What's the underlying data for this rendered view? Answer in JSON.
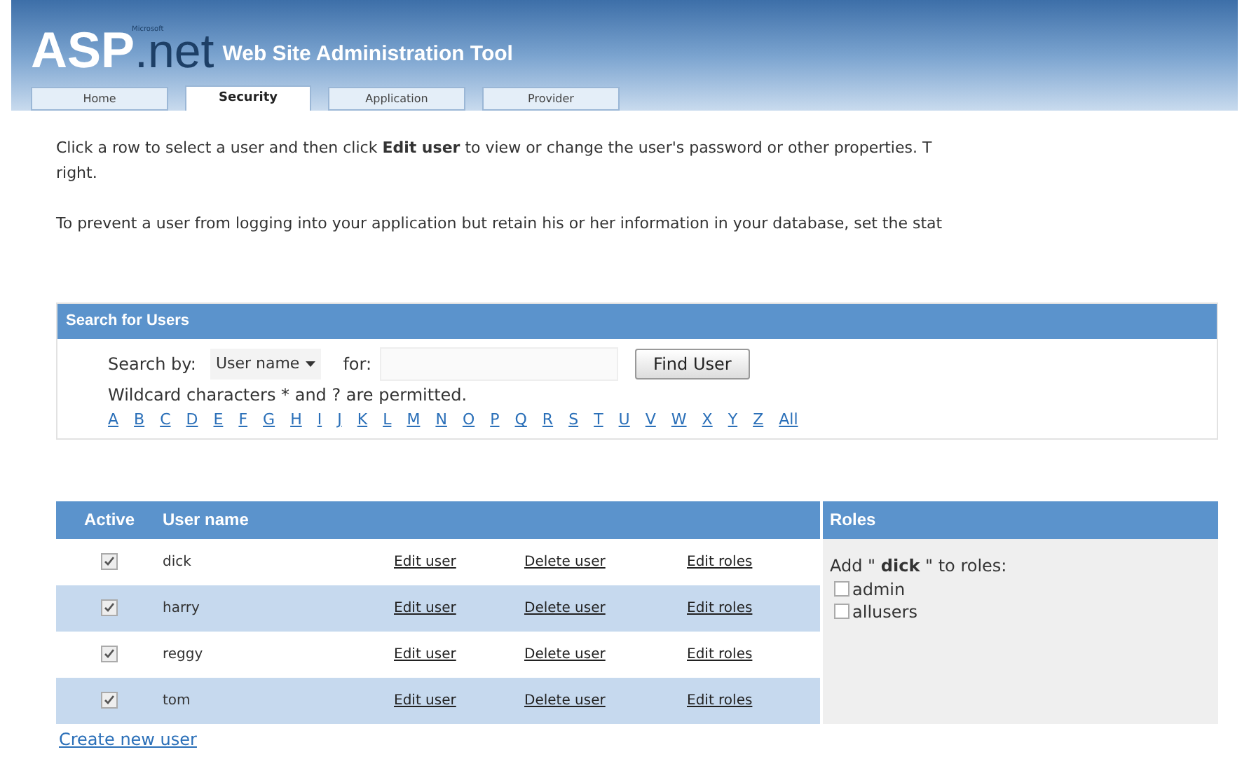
{
  "header": {
    "logo_main": "ASP",
    "logo_sub": ".net",
    "logo_small": "Microsoft",
    "title": "Web Site Administration Tool"
  },
  "tabs": [
    {
      "label": "Home",
      "selected": false
    },
    {
      "label": "Security",
      "selected": true
    },
    {
      "label": "Application",
      "selected": false
    },
    {
      "label": "Provider",
      "selected": false
    }
  ],
  "intro": {
    "paragraph_1": [
      "Click a row to select a user and then click **Edit user** to view or change the user's password or other properties. T",
      "right."
    ],
    "paragraph_2": "To prevent a user from logging into your application but retain his or her information in your database, set the stat"
  },
  "search": {
    "title": "Search for Users",
    "search_by_label": "Search by:",
    "search_by_value": "User name",
    "for_label": "for:",
    "button": "Find User",
    "hint": "Wildcard characters * and ? are permitted.",
    "letters": [
      "A",
      "B",
      "C",
      "D",
      "E",
      "F",
      "G",
      "H",
      "I",
      "J",
      "K",
      "L",
      "M",
      "N",
      "O",
      "P",
      "Q",
      "R",
      "S",
      "T",
      "U",
      "V",
      "W",
      "X",
      "Y",
      "Z",
      "All"
    ]
  },
  "users": {
    "columns": [
      "Active",
      "User name"
    ],
    "rows": [
      {
        "active": true,
        "name": "dick",
        "edit": "Edit user",
        "delete": "Delete user",
        "roles": "Edit roles"
      },
      {
        "active": true,
        "name": "harry",
        "edit": "Edit user",
        "delete": "Delete user",
        "roles": "Edit roles"
      },
      {
        "active": true,
        "name": "reggy",
        "edit": "Edit user",
        "delete": "Delete user",
        "roles": "Edit roles"
      },
      {
        "active": true,
        "name": "tom",
        "edit": "Edit user",
        "delete": "Delete user",
        "roles": "Edit roles"
      }
    ]
  },
  "roles": {
    "title": "Roles",
    "prompt": "Add \" **dick** \" to roles:",
    "items": [
      {
        "label": "admin",
        "checked": false
      },
      {
        "label": "allusers",
        "checked": false
      }
    ]
  },
  "create_link": "Create new user"
}
